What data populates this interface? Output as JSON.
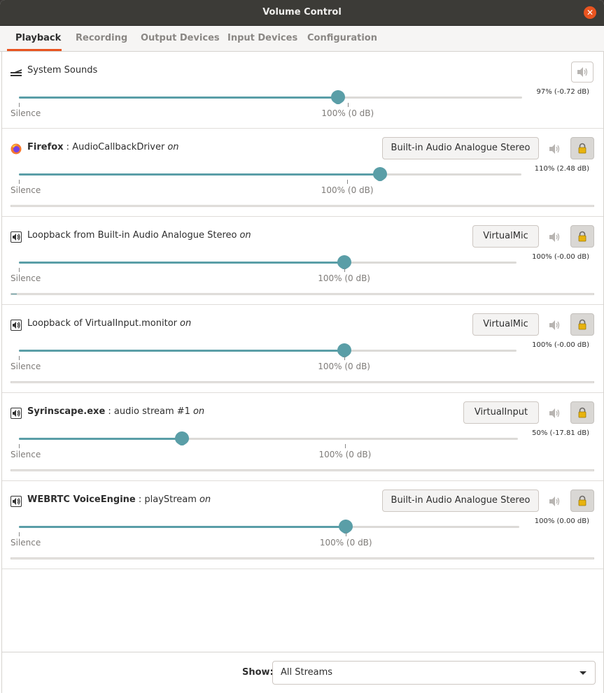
{
  "window": {
    "title": "Volume Control",
    "close_glyph": "✕"
  },
  "tabs": [
    {
      "label": "Playback",
      "active": true
    },
    {
      "label": "Recording",
      "active": false
    },
    {
      "label": "Output Devices",
      "active": false
    },
    {
      "label": "Input Devices",
      "active": false
    },
    {
      "label": "Configuration",
      "active": false
    }
  ],
  "scale_labels": {
    "silence": "Silence",
    "hundred": "100% (0 dB)"
  },
  "streams": [
    {
      "kind": "system",
      "name": "System Sounds",
      "volume_text": "97% (-0.72 dB)",
      "volume_percent": 97
    },
    {
      "kind": "app",
      "app": "Firefox",
      "sep": " : ",
      "detail": "AudioCallbackDriver",
      "status": "on",
      "device": "Built-in Audio Analogue Stereo",
      "volume_text": "110% (2.48 dB)",
      "volume_percent": 110,
      "peak_percent": 0
    },
    {
      "kind": "loopback",
      "name": "Loopback from Built-in Audio Analogue Stereo",
      "status": "on",
      "device": "VirtualMic",
      "volume_text": "100% (-0.00 dB)",
      "volume_percent": 100,
      "peak_percent": 1
    },
    {
      "kind": "loopback",
      "name": "Loopback of VirtualInput.monitor",
      "status": "on",
      "device": "VirtualMic",
      "volume_text": "100% (-0.00 dB)",
      "volume_percent": 100,
      "peak_percent": 0
    },
    {
      "kind": "app",
      "app": "Syrinscape.exe",
      "sep": " : ",
      "detail": "audio stream #1",
      "status": "on",
      "device": "VirtualInput",
      "volume_text": "50% (-17.81 dB)",
      "volume_percent": 50,
      "peak_percent": 0
    },
    {
      "kind": "app",
      "app": "WEBRTC VoiceEngine",
      "sep": " : ",
      "detail": "playStream",
      "status": "on",
      "device": "Built-in Audio Analogue Stereo",
      "volume_text": "100% (0.00 dB)",
      "volume_percent": 100,
      "peak_percent": 0
    }
  ],
  "footer": {
    "show_label": "Show:",
    "show_value": "All Streams"
  },
  "colors": {
    "accent": "#e95420",
    "slider": "#5a9ea7",
    "titlebar": "#3c3b37"
  }
}
